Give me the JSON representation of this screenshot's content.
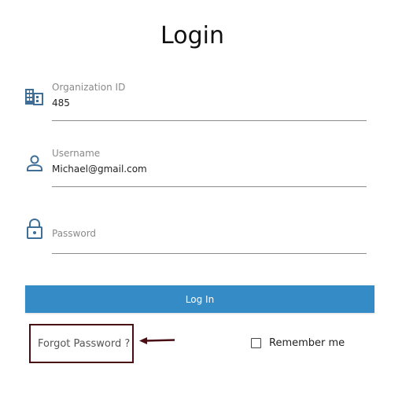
{
  "title": "Login",
  "fields": {
    "org": {
      "label": "Organization ID",
      "value": "485",
      "icon": "building-icon"
    },
    "username": {
      "label": "Username",
      "value": "Michael@gmail.com",
      "icon": "person-icon"
    },
    "password": {
      "label": "Password",
      "value": "",
      "icon": "lock-icon"
    }
  },
  "login_button": "Log In",
  "forgot_password": "Forgot Password ?",
  "remember_me": {
    "label": "Remember me",
    "checked": false
  },
  "colors": {
    "accent": "#358bc5",
    "icon": "#3f6f96",
    "annotation": "#4a0d14"
  }
}
